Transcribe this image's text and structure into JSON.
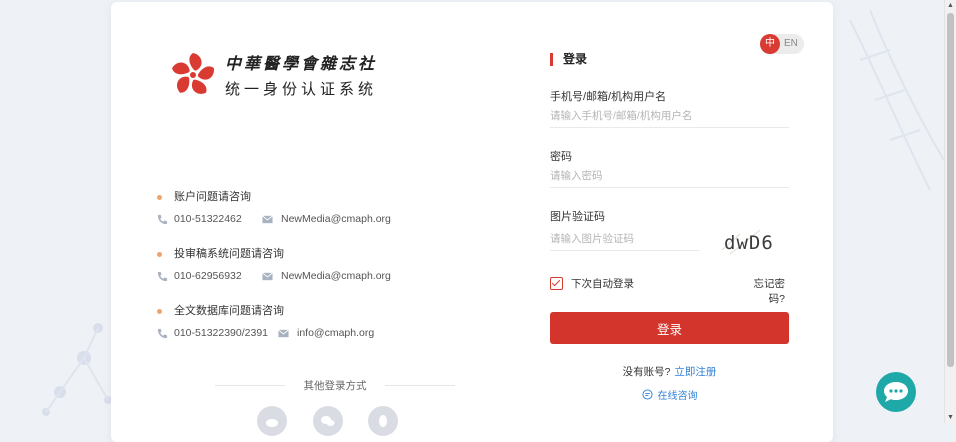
{
  "logo": {
    "line1": "中華醫學會雜志社",
    "line2": "统一身份认证系统"
  },
  "contacts": [
    {
      "title": "账户问题请咨询",
      "phone": "010-51322462",
      "email": "NewMedia@cmaph.org"
    },
    {
      "title": "投审稿系统问题请咨询",
      "phone": "010-62956932",
      "email": "NewMedia@cmaph.org"
    },
    {
      "title": "全文数据库问题请咨询",
      "phone": "010-51322390/2391",
      "email": "info@cmaph.org"
    }
  ],
  "other_login": {
    "label": "其他登录方式",
    "icons": [
      "weibo-icon",
      "wechat-icon",
      "qq-icon"
    ]
  },
  "language": {
    "cn": "中",
    "en": "EN"
  },
  "login_form": {
    "title": "登录",
    "username_label": "手机号/邮箱/机构用户名",
    "username_placeholder": "请输入手机号/邮箱/机构用户名",
    "password_label": "密码",
    "password_placeholder": "请输入密码",
    "captcha_label": "图片验证码",
    "captcha_placeholder": "请输入图片验证码",
    "captcha_text": "dwD6",
    "remember_label": "下次自动登录",
    "forgot_label": "忘记密码?",
    "submit_label": "登录",
    "register_prompt": "没有账号?",
    "register_link": "立即注册",
    "online_consult": "在线咨询"
  },
  "colors": {
    "accent": "#d3342c",
    "link": "#2f7fd6",
    "chat_fab": "#1fa8a8"
  }
}
